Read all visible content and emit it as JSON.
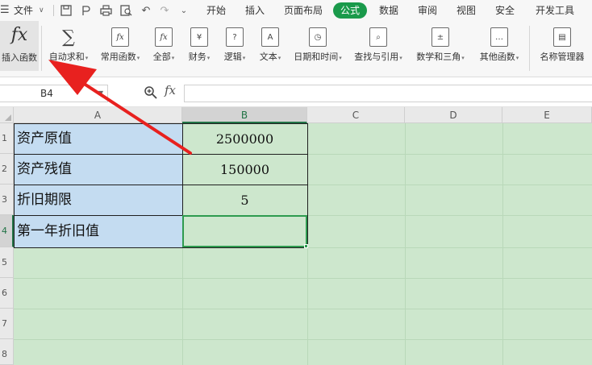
{
  "menubar": {
    "file_label": "文件",
    "tabs": [
      {
        "label": "开始"
      },
      {
        "label": "插入"
      },
      {
        "label": "页面布局"
      },
      {
        "label": "公式"
      },
      {
        "label": "数据"
      },
      {
        "label": "审阅"
      },
      {
        "label": "视图"
      },
      {
        "label": "安全"
      },
      {
        "label": "开发工具"
      }
    ],
    "active_tab": "公式",
    "accent_color": "#1a9a4b"
  },
  "ribbon": {
    "insert_function": {
      "icon": "fx",
      "label": "插入函数"
    },
    "buttons": [
      {
        "label": "自动求和",
        "icon": "sigma-icon",
        "glyph": "∑",
        "dropdown": true
      },
      {
        "label": "常用函数",
        "icon": "common-function-icon",
        "glyph": "fx",
        "dropdown": true
      },
      {
        "label": "全部",
        "icon": "all-functions-icon",
        "glyph": "fx",
        "dropdown": true
      },
      {
        "label": "财务",
        "icon": "finance-icon",
        "glyph": "¥",
        "dropdown": true
      },
      {
        "label": "逻辑",
        "icon": "logic-icon",
        "glyph": "?",
        "dropdown": true
      },
      {
        "label": "文本",
        "icon": "text-icon",
        "glyph": "A",
        "dropdown": true
      },
      {
        "label": "日期和时间",
        "icon": "datetime-icon",
        "glyph": "◷",
        "dropdown": true
      },
      {
        "label": "查找与引用",
        "icon": "lookup-icon",
        "glyph": "⌕",
        "dropdown": true
      },
      {
        "label": "数学和三角",
        "icon": "math-trig-icon",
        "glyph": "±",
        "dropdown": true
      },
      {
        "label": "其他函数",
        "icon": "more-functions-icon",
        "glyph": "…",
        "dropdown": true
      },
      {
        "label": "名称管理器",
        "icon": "name-manager-icon",
        "glyph": "▤",
        "dropdown": false
      }
    ]
  },
  "formula_bar": {
    "name_box": "B4",
    "fx_label": "fx",
    "formula": ""
  },
  "grid": {
    "columns": [
      "A",
      "B",
      "C",
      "D",
      "E"
    ],
    "rows": [
      "1",
      "2",
      "3",
      "4",
      "5",
      "6",
      "7",
      "8"
    ],
    "selected_column": "B",
    "selected_row": "4",
    "cells": [
      {
        "label": "资产原值",
        "value": "2500000"
      },
      {
        "label": "资产残值",
        "value": "150000"
      },
      {
        "label": "折旧期限",
        "value": "5"
      },
      {
        "label": "第一年折旧值",
        "value": ""
      }
    ],
    "sheet_bg_color": "#cde7cd",
    "label_bg_color": "#c4dcf1"
  },
  "annotation": {
    "arrow_color": "#e8211f"
  }
}
